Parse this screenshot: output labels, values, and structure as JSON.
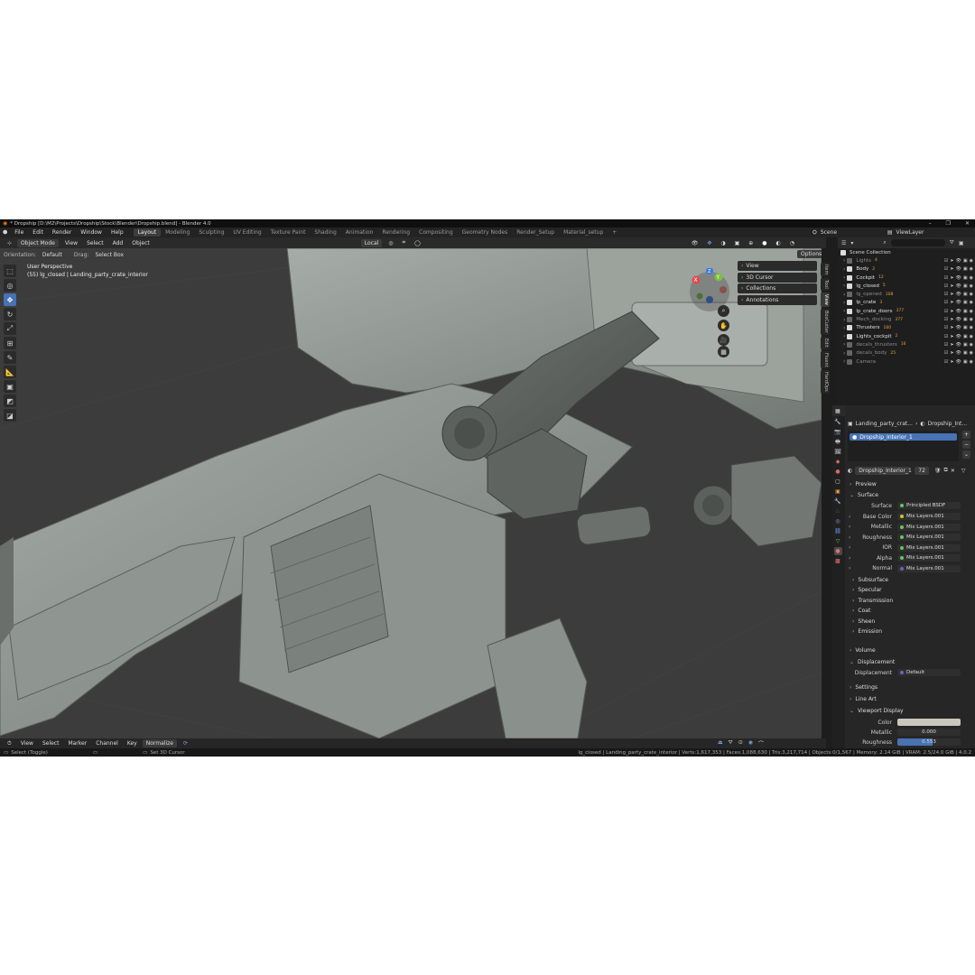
{
  "window": {
    "title": "* Dropship [D:\\M2\\Projects\\Dropship\\Stock\\Blender\\Dropship.blend] - Blender 4.0",
    "controls": [
      "–",
      "❐",
      "✕"
    ]
  },
  "menu": {
    "items": [
      "File",
      "Edit",
      "Render",
      "Window",
      "Help"
    ]
  },
  "workspaces": {
    "tabs": [
      "Layout",
      "Modeling",
      "Sculpting",
      "UV Editing",
      "Texture Paint",
      "Shading",
      "Animation",
      "Rendering",
      "Compositing",
      "Geometry Nodes",
      "Render_Setup",
      "Material_setup"
    ],
    "add": "+"
  },
  "scene": {
    "label": "Scene",
    "view_layer": "ViewLayer"
  },
  "header3d": {
    "mode": "Object Mode",
    "view": "View",
    "select": "Select",
    "add": "Add",
    "object": "Object",
    "transform": "Local",
    "options": "Options"
  },
  "subheader": {
    "orientation_label": "Orientation:",
    "orientation_value": "Default",
    "drag_label": "Drag:",
    "drag_value": "Select Box"
  },
  "viewport": {
    "perspective": "User Perspective",
    "object_info": "(55) lg_closed | Landing_party_crate_interior"
  },
  "npanel": {
    "items": [
      "View",
      "3D Cursor",
      "Collections",
      "Annotations"
    ],
    "side_tabs": [
      "Item",
      "Tool",
      "View",
      "BoxCutter",
      "Edit",
      "Fluent",
      "HardOps"
    ]
  },
  "gizmo": {
    "x": "X",
    "y": "Y",
    "z": "Z",
    "colors": {
      "x": "#e04a4a",
      "y": "#79c23b",
      "z": "#3c7ae0"
    }
  },
  "outliner": {
    "root": "Scene Collection",
    "rows": [
      {
        "name": "Lights",
        "badge": "4",
        "dim": true
      },
      {
        "name": "Body",
        "badge": "2",
        "dim": false
      },
      {
        "name": "Cockpit",
        "badge": "12",
        "dim": false
      },
      {
        "name": "lg_closed",
        "badge": "5",
        "dim": false
      },
      {
        "name": "lg_opened",
        "badge": "108",
        "dim": true
      },
      {
        "name": "lp_crate",
        "badge": "3",
        "dim": false
      },
      {
        "name": "lp_crate_doors",
        "badge": "377",
        "dim": false
      },
      {
        "name": "Mech_docking",
        "badge": "377",
        "dim": true
      },
      {
        "name": "Thrusters",
        "badge": "160",
        "dim": false
      },
      {
        "name": "Lights_cockpit",
        "badge": "2",
        "dim": false
      },
      {
        "name": "decals_thrusters",
        "badge": "16",
        "dim": true
      },
      {
        "name": "decals_body",
        "badge": "25",
        "dim": true
      },
      {
        "name": "Camera",
        "badge": "",
        "dim": true
      }
    ]
  },
  "properties": {
    "breadcrumb_object": "Landing_party_crat...",
    "breadcrumb_material": "Dropship_Int...",
    "slot": "Dropship_Interior_1",
    "material_name": "Dropship_Interior_1",
    "users": "72",
    "sections": {
      "preview": "Preview",
      "surface": "Surface",
      "volume": "Volume",
      "displacement": "Displacement",
      "settings": "Settings",
      "line_art": "Line Art",
      "viewport_display": "Viewport Display"
    },
    "surface_label": "Surface",
    "surface_value": "Principled BSDF",
    "inputs": [
      {
        "label": "Base Color",
        "value": "Mix Layers.001"
      },
      {
        "label": "Metallic",
        "value": "Mix Layers.001"
      },
      {
        "label": "Roughness",
        "value": "Mix Layers.001"
      },
      {
        "label": "IOR",
        "value": "Mix Layers.001"
      },
      {
        "label": "Alpha",
        "value": "Mix Layers.001"
      },
      {
        "label": "Normal",
        "value": "Mix Layers.001"
      }
    ],
    "subpanels": [
      "Subsurface",
      "Specular",
      "Transmission",
      "Coat",
      "Sheen",
      "Emission"
    ],
    "displacement_label": "Displacement",
    "displacement_value": "Default",
    "vd_color_label": "Color",
    "vd_metallic_label": "Metallic",
    "vd_metallic_value": "0.000",
    "vd_roughness_label": "Roughness",
    "vd_roughness_value": "0.553",
    "vd_roughness_fraction": 0.553
  },
  "timeline": {
    "items": [
      "View",
      "Select",
      "Marker",
      "Channel",
      "Key"
    ],
    "normalize": "Normalize"
  },
  "status": {
    "left": "Select (Toggle)",
    "middle": "Set 3D Cursor",
    "right": "lg_closed | Landing_party_crate_interior | Verts:1,617,353 | Faces:1,088,630 | Tris:3,217,714 | Objects:0/1,567 | Memory: 2.14 GiB | VRAM: 2.5/24.0 GiB | 4.0.2"
  }
}
